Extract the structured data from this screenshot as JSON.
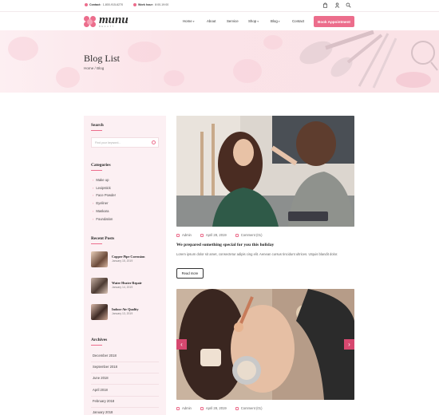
{
  "topbar": {
    "contact_label": "Contact:",
    "contact_value": "1-800-915-6270",
    "hours_label": "Work hour:",
    "hours_value": "8:00-19:00"
  },
  "header": {
    "logo_text": "munu",
    "logo_sub": "BEAUTY",
    "nav": [
      {
        "label": "Home",
        "caret": true
      },
      {
        "label": "About",
        "caret": false
      },
      {
        "label": "Service",
        "caret": false
      },
      {
        "label": "Shop",
        "caret": true
      },
      {
        "label": "Blog",
        "caret": true
      },
      {
        "label": "Contact",
        "caret": false
      }
    ],
    "book_button": "Book Appointment"
  },
  "banner": {
    "title": "Blog List",
    "breadcrumb": "Home / Blog"
  },
  "sidebar": {
    "search_title": "Search",
    "search_placeholder": "Find your keyword...",
    "categories_title": "Categories",
    "categories": [
      "Make up",
      "Lexipstick",
      "Face Powder",
      "Eyeliner",
      "Maskara",
      "Foundation"
    ],
    "recent_title": "Recent Posts",
    "recent_posts": [
      {
        "title": "Copper Pipe Corrosion",
        "date": "January 15, 2019"
      },
      {
        "title": "Water Heater Repair",
        "date": "January 14, 2019"
      },
      {
        "title": "Indoor Air Quality",
        "date": "January 13, 2019"
      }
    ],
    "archives_title": "Archives",
    "archives": [
      "December 2018",
      "September 2018",
      "June 2018",
      "April 2018",
      "February 2018",
      "January 2018"
    ]
  },
  "posts": [
    {
      "author": "Admin",
      "date": "April 28, 2019",
      "comments": "Comment (01)",
      "title": "We prepared something special for you this holiday",
      "excerpt": "Lorem ipsum dolor sit amet, consectetur adipis cing elit. Aenean cursus tincidunt ultrices. Utquis blandit dolor.",
      "read_more": "Read more"
    },
    {
      "author": "Admin",
      "date": "April 28, 2019",
      "comments": "Comment (01)"
    }
  ],
  "colors": {
    "accent": "#ec6d8c",
    "banner_bg": "#fbe3e8",
    "sidebar_bg": "#fcf0f3"
  },
  "icons": [
    "phone-icon",
    "clock-icon",
    "cart-icon",
    "user-icon",
    "search-icon",
    "user-meta-icon",
    "calendar-icon",
    "comment-icon",
    "chevron-left-icon",
    "chevron-right-icon"
  ]
}
